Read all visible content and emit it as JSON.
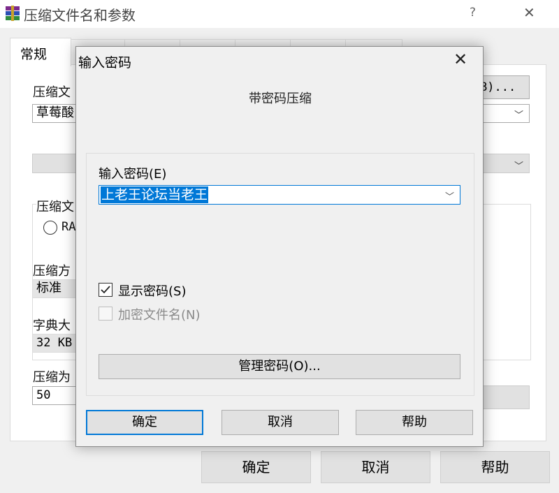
{
  "main_window": {
    "title": "压缩文件名和参数",
    "help_glyph": "?",
    "close_glyph": "✕",
    "tabs": [
      {
        "label": "常规",
        "active": true
      }
    ],
    "labels": {
      "archive_name": "压缩文",
      "archive_name_value": "草莓酸",
      "browse_suffix": "B)...",
      "format_group": "压缩文",
      "format_radio": "RA",
      "method": "压缩方",
      "method_value": "标准",
      "dictionary": "字典大",
      "dictionary_value": "32 KB",
      "split": "压缩为",
      "split_value": "50"
    },
    "buttons": {
      "ok": "确定",
      "cancel": "取消",
      "help": "帮助"
    }
  },
  "dialog": {
    "title": "输入密码",
    "close_glyph": "✕",
    "subtitle": "带密码压缩",
    "password_label": "输入密码(E)",
    "password_value": "上老王论坛当老王",
    "show_password": {
      "label": "显示密码(S)",
      "checked": true,
      "enabled": true
    },
    "encrypt_names": {
      "label": "加密文件名(N)",
      "checked": false,
      "enabled": false
    },
    "manage_button": "管理密码(O)...",
    "buttons": {
      "ok": "确定",
      "cancel": "取消",
      "help": "帮助"
    }
  },
  "colors": {
    "accent": "#0078d7",
    "disabled_text": "#8a8a8a"
  }
}
